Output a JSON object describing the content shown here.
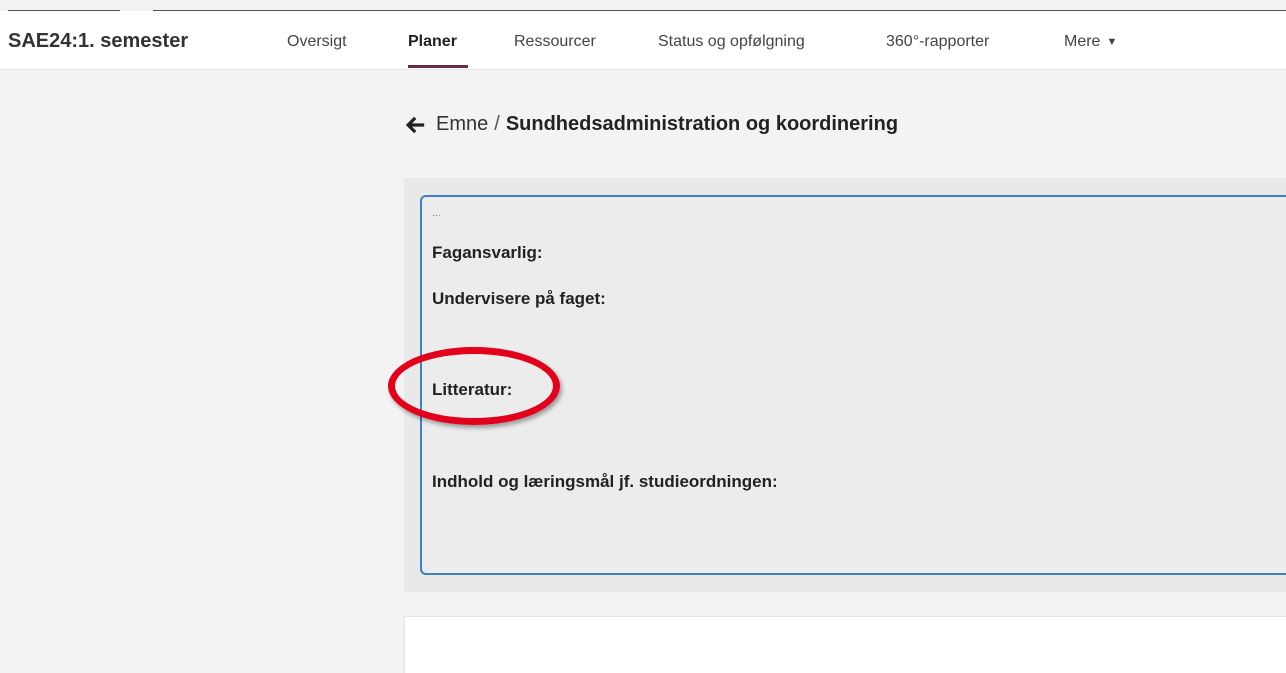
{
  "header": {
    "app_title": "SAE24:1. semester",
    "nav": [
      {
        "label": "Oversigt",
        "active": false
      },
      {
        "label": "Planer",
        "active": true
      },
      {
        "label": "Ressourcer",
        "active": false
      },
      {
        "label": "Status og opfølgning",
        "active": false
      },
      {
        "label": "360°-rapporter",
        "active": false
      },
      {
        "label": "Mere",
        "active": false
      }
    ],
    "accent_color": "#6b2c4a"
  },
  "breadcrumb": {
    "back_icon": "arrow-left-icon",
    "parent": "Emne",
    "separator": "/",
    "current": "Sundhedsadministration og koordinering"
  },
  "editor": {
    "ellipsis": "...",
    "fields": [
      "Fagansvarlig:",
      "Undervisere på faget:",
      "Litteratur:",
      "Indhold og læringsmål jf. studieordningen:"
    ],
    "border_color": "#3f7fc4"
  },
  "annotation": {
    "highlight_color": "#e3001b"
  }
}
